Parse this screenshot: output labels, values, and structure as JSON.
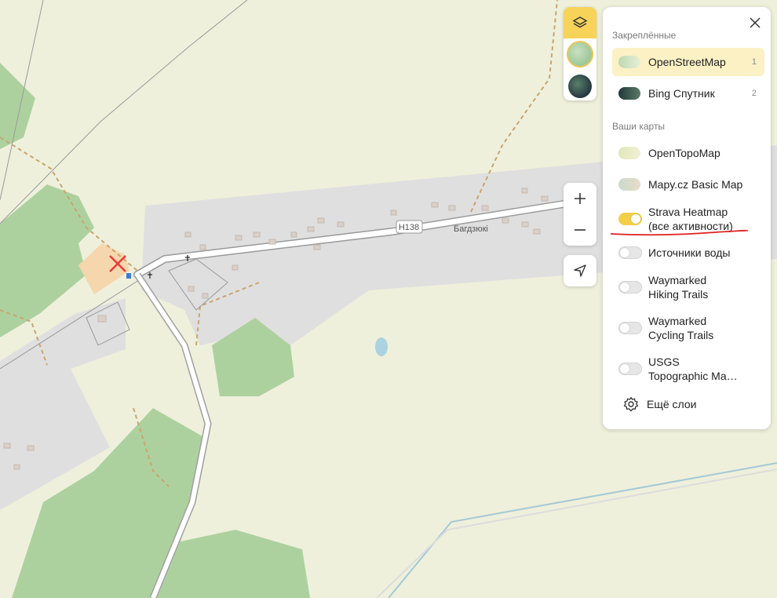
{
  "map": {
    "road_label": "Н138",
    "place_label": "Багдзюкі"
  },
  "layers_panel": {
    "pinned_title": "Закреплённые",
    "pinned": [
      {
        "label": "OpenStreetMap",
        "shortcut": "1",
        "selected": true,
        "thumb_color": "#bcd9b2"
      },
      {
        "label": "Bing Спутник",
        "shortcut": "2",
        "selected": false,
        "thumb_color": "#2f4a3f"
      }
    ],
    "your_maps_title": "Ваши карты",
    "base_maps": [
      {
        "label": "OpenTopoMap",
        "thumb_color": "#dfe9b8"
      },
      {
        "label": "Mapy.cz Basic Map",
        "thumb_color": "#c9d9d0"
      }
    ],
    "overlays": [
      {
        "line1": "Strava Heatmap",
        "line2": "(все активности)",
        "on": true
      },
      {
        "line1": "Источники воды",
        "line2": "",
        "on": false
      },
      {
        "line1": "Waymarked",
        "line2": "Hiking Trails",
        "on": false
      },
      {
        "line1": "Waymarked",
        "line2": "Cycling Trails",
        "on": false
      },
      {
        "line1": "USGS",
        "line2": "Topographic Ma…",
        "on": false
      }
    ],
    "more_label": "Ещё слои"
  },
  "colors": {
    "accent": "#f2cf46",
    "selected_row": "#fbf1c5",
    "forest": "#add19e",
    "residential": "#e0dfdf",
    "background": "#eef0dc"
  }
}
